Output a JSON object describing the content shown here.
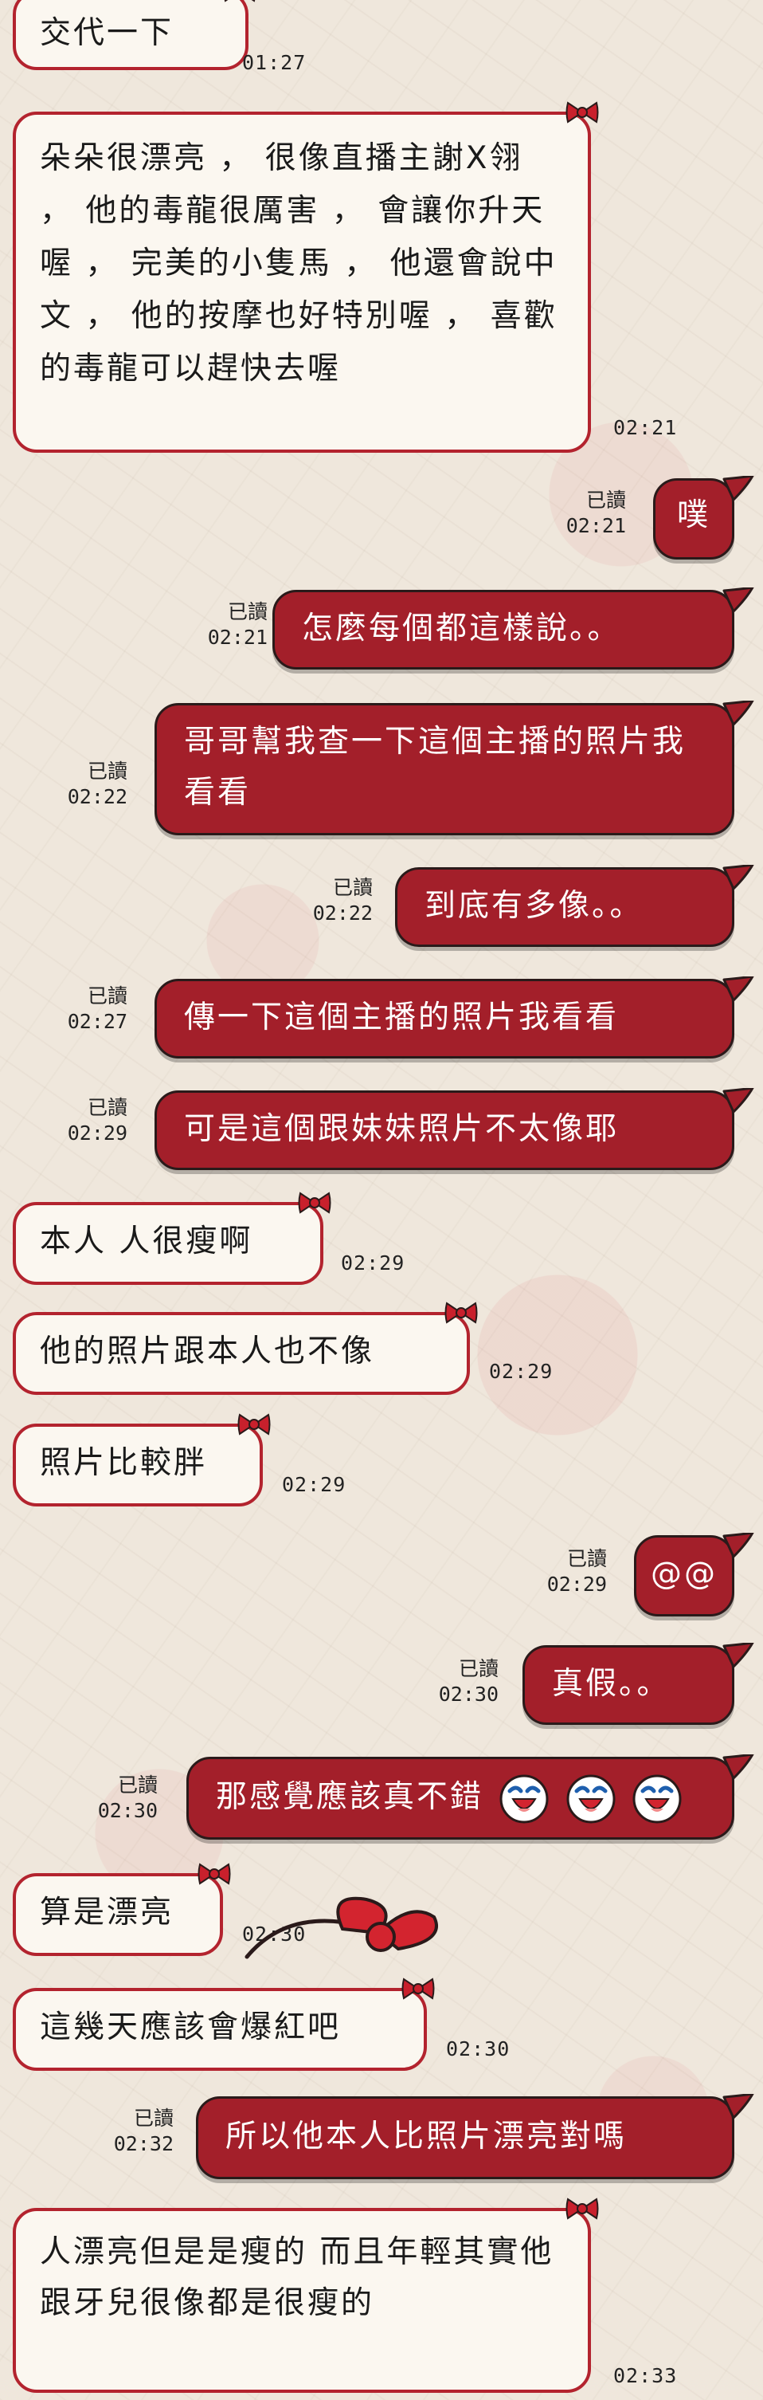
{
  "colors": {
    "incoming_bg": "#fbf7f0",
    "incoming_border": "#b3232e",
    "outgoing_bg": "#a31f2a",
    "accent_red": "#d3242f"
  },
  "messages": [
    {
      "text": "交代一下",
      "time": "01:27"
    },
    {
      "text": "朵朵很漂亮 ， 很像直播主謝X翎 ， 他的毒龍很厲害 ， 會讓你升天喔 ， 完美的小隻馬 ， 他還會說中文 ， 他的按摩也好特別喔 ， 喜歡的毒龍可以趕快去喔",
      "time": "02:21"
    },
    {
      "text": "噗",
      "read": "已讀",
      "time": "02:21"
    },
    {
      "text": "怎麼每個都這樣說。。",
      "read": "已讀",
      "time": "02:21"
    },
    {
      "text": "哥哥幫我查一下這個主播的照片我看看",
      "read": "已讀",
      "time": "02:22"
    },
    {
      "text": "到底有多像。。",
      "read": "已讀",
      "time": "02:22"
    },
    {
      "text": "傳一下這個主播的照片我看看",
      "read": "已讀",
      "time": "02:27"
    },
    {
      "text": "可是這個跟妹妹照片不太像耶",
      "read": "已讀",
      "time": "02:29"
    },
    {
      "text": "本人 人很瘦啊",
      "time": "02:29"
    },
    {
      "text": "他的照片跟本人也不像",
      "time": "02:29"
    },
    {
      "text": "照片比較胖",
      "time": "02:29"
    },
    {
      "text": "@@",
      "read": "已讀",
      "time": "02:29"
    },
    {
      "text": "真假。。",
      "read": "已讀",
      "time": "02:30"
    },
    {
      "text": "那感覺應該真不錯",
      "read": "已讀",
      "time": "02:30",
      "icons": [
        "laughing-face-icon",
        "laughing-face-icon",
        "laughing-face-icon"
      ]
    },
    {
      "text": "算是漂亮",
      "time": "02:30"
    },
    {
      "text": "這幾天應該會爆紅吧",
      "time": "02:30"
    },
    {
      "text": "所以他本人比照片漂亮對嗎",
      "read": "已讀",
      "time": "02:32"
    },
    {
      "text": "人漂亮但是是瘦的 而且年輕其實他跟牙兒很像都是很瘦的",
      "time": "02:33"
    }
  ]
}
